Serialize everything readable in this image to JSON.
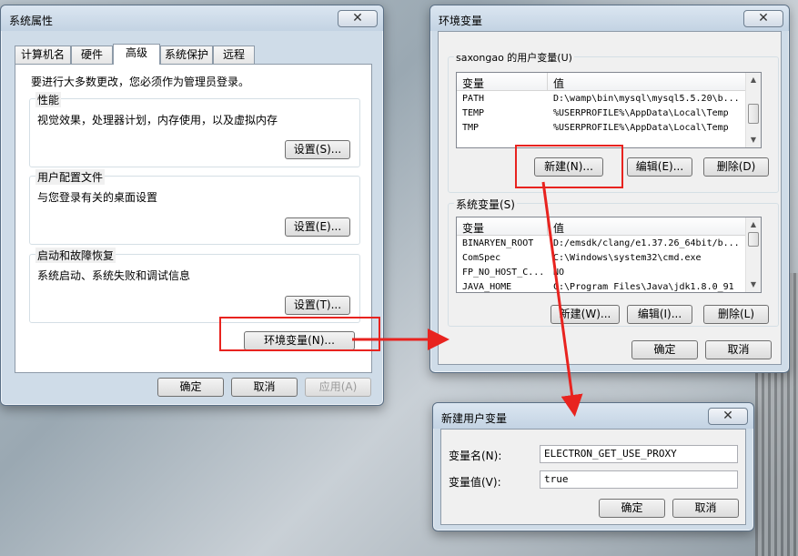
{
  "system_properties": {
    "title": "系统属性",
    "tabs": [
      "计算机名",
      "硬件",
      "高级",
      "系统保护",
      "远程"
    ],
    "active_tab": "高级",
    "admin_note": "要进行大多数更改，您必须作为管理员登录。",
    "performance": {
      "label": "性能",
      "desc": "视觉效果，处理器计划，内存使用，以及虚拟内存",
      "button": "设置(S)..."
    },
    "user_profiles": {
      "label": "用户配置文件",
      "desc": "与您登录有关的桌面设置",
      "button": "设置(E)..."
    },
    "startup_recovery": {
      "label": "启动和故障恢复",
      "desc": "系统启动、系统失败和调试信息",
      "button": "设置(T)..."
    },
    "env_button": "环境变量(N)...",
    "ok": "确定",
    "cancel": "取消",
    "apply": "应用(A)"
  },
  "env_vars": {
    "title": "环境变量",
    "user_group_label": "saxongao 的用户变量(U)",
    "col_var": "变量",
    "col_val": "值",
    "user_vars": [
      {
        "name": "PATH",
        "value": "D:\\wamp\\bin\\mysql\\mysql5.5.20\\b..."
      },
      {
        "name": "TEMP",
        "value": "%USERPROFILE%\\AppData\\Local\\Temp"
      },
      {
        "name": "TMP",
        "value": "%USERPROFILE%\\AppData\\Local\\Temp"
      }
    ],
    "user_new": "新建(N)...",
    "user_edit": "编辑(E)...",
    "user_delete": "删除(D)",
    "sys_group_label": "系统变量(S)",
    "sys_vars": [
      {
        "name": "BINARYEN_ROOT",
        "value": "D:/emsdk/clang/e1.37.26_64bit/b..."
      },
      {
        "name": "ComSpec",
        "value": "C:\\Windows\\system32\\cmd.exe"
      },
      {
        "name": "FP_NO_HOST_C...",
        "value": "NO"
      },
      {
        "name": "JAVA_HOME",
        "value": "C:\\Program Files\\Java\\jdk1.8.0_91"
      }
    ],
    "sys_new": "新建(W)...",
    "sys_edit": "编辑(I)...",
    "sys_delete": "删除(L)",
    "ok": "确定",
    "cancel": "取消"
  },
  "new_user_var": {
    "title": "新建用户变量",
    "name_label": "变量名(N):",
    "name_value": "ELECTRON_GET_USE_PROXY",
    "value_label": "变量值(V):",
    "value_value": "true",
    "ok": "确定",
    "cancel": "取消"
  },
  "icons": {
    "close": "close-icon",
    "scroll_up": "chevron-up-icon",
    "scroll_down": "chevron-down-icon"
  },
  "annotation_color": "#e8231f"
}
